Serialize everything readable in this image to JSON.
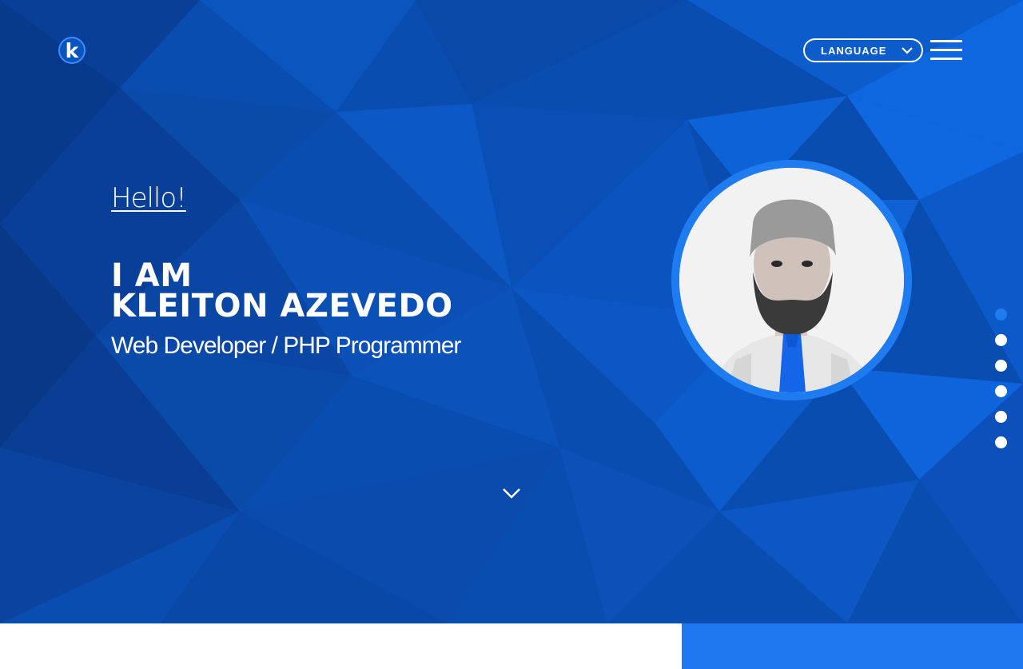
{
  "header": {
    "logo_letter": "k",
    "language_label": "LANGUAGE"
  },
  "hero": {
    "greeting": "Hello!",
    "intro": "I AM",
    "name": "KLEITON AZEVEDO",
    "role": "Web Developer / PHP Programmer"
  },
  "icons": {
    "language_chevron": "chevron-down-icon",
    "menu": "hamburger-menu-icon",
    "scroll": "chevron-down-icon",
    "logo": "k-logo-icon"
  },
  "section_nav": {
    "count": 6,
    "active_index": 0
  },
  "colors": {
    "hero_background": "#0a4fb3",
    "accent": "#1f7cf0",
    "text": "#ffffff"
  }
}
